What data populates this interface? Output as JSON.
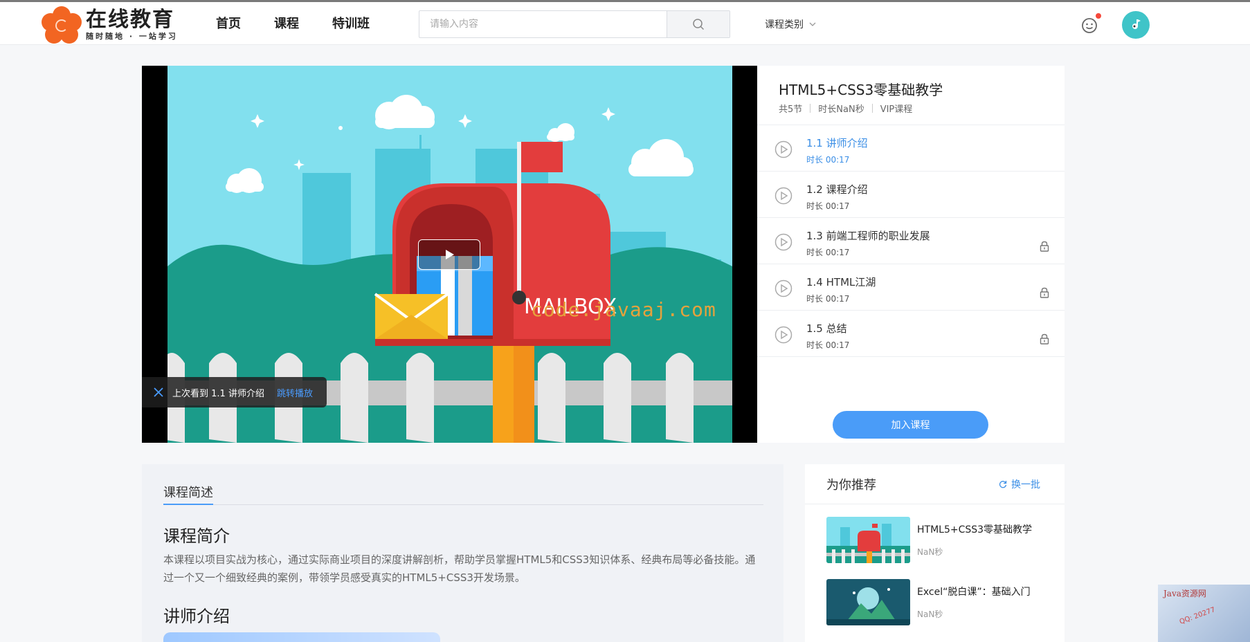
{
  "header": {
    "logo_title": "在线教育",
    "logo_subtitle": "随时随地 · 一站学习",
    "nav": [
      "首页",
      "课程",
      "特训班"
    ],
    "search_placeholder": "请输入内容",
    "category_label": "课程类别",
    "colors": {
      "brand": "#f26522",
      "accent": "#4a9cf8",
      "avatar_bg": "#3fc4c8",
      "notify_dot": "#f5483b"
    },
    "icons": [
      "search-icon",
      "chevron-down-icon",
      "message-icon",
      "avatar-icon"
    ]
  },
  "player": {
    "watermark": "code.javaaj.com",
    "scene_text": "MAILBOX",
    "resume_text": "上次看到 1.1 讲师介绍",
    "resume_link": "跳转播放"
  },
  "course": {
    "title": "HTML5+CSS3零基础教学",
    "meta": [
      "共5节",
      "时长NaN秒",
      "VIP课程"
    ],
    "chapters": [
      {
        "name": "1.1 讲师介绍",
        "duration": "时长 00:17",
        "active": true,
        "locked": false
      },
      {
        "name": "1.2 课程介绍",
        "duration": "时长 00:17",
        "active": false,
        "locked": false
      },
      {
        "name": "1.3 前端工程师的职业发展",
        "duration": "时长 00:17",
        "active": false,
        "locked": true
      },
      {
        "name": "1.4 HTML江湖",
        "duration": "时长 00:17",
        "active": false,
        "locked": true
      },
      {
        "name": "1.5 总结",
        "duration": "时长 00:17",
        "active": false,
        "locked": true
      }
    ],
    "join_label": "加入课程"
  },
  "description": {
    "tab": "课程简述",
    "intro_title": "课程简介",
    "intro_text": "本课程以项目实战为核心，通过实际商业项目的深度讲解剖析，帮助学员掌握HTML5和CSS3知识体系、经典布局等必备技能。通过一个又一个细致经典的案例，带领学员感受真实的HTML5+CSS3开发场景。",
    "teacher_title": "讲师介绍"
  },
  "recommend": {
    "title": "为你推荐",
    "refresh_label": "换一批",
    "items": [
      {
        "name": "HTML5+CSS3零基础教学",
        "duration": "NaN秒"
      },
      {
        "name": "Excel“脱白课”：基础入门",
        "duration": "NaN秒"
      }
    ]
  },
  "corner": {
    "text": "Java资源网",
    "qq": "QQ: 20277"
  }
}
